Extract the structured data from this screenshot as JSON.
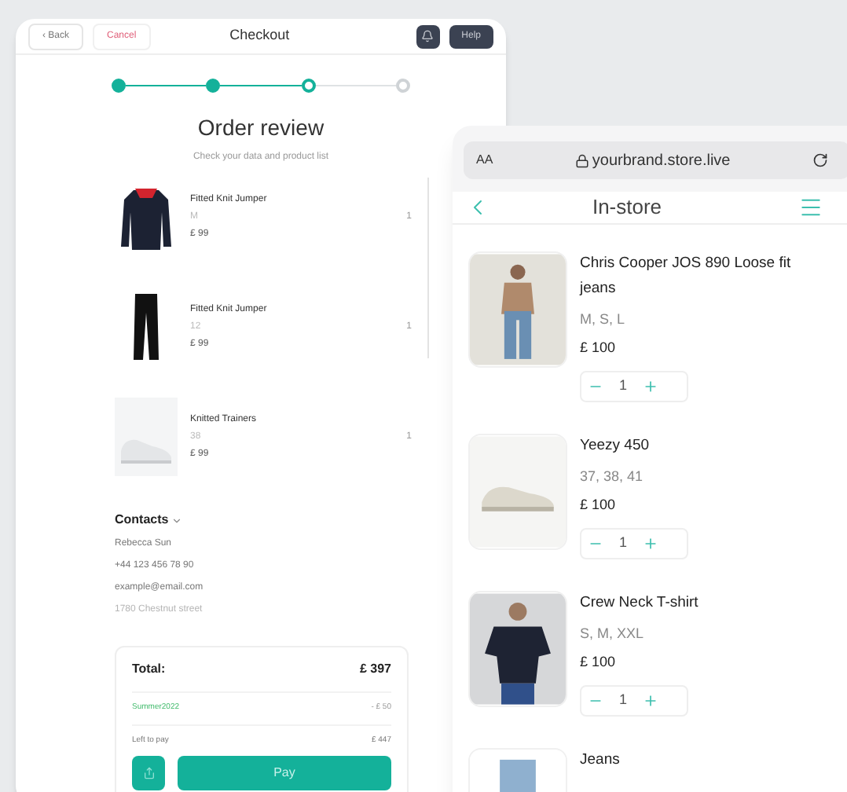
{
  "checkout": {
    "back": "‹ Back",
    "cancel": "Cancel",
    "title": "Checkout",
    "help": "Help",
    "steps": [
      {
        "kind": "done"
      },
      {
        "kind": "done"
      },
      {
        "kind": "current"
      },
      {
        "kind": "pending"
      }
    ],
    "heading": "Order review",
    "subheading": "Check your data and product list",
    "items": [
      {
        "kind": "jumper",
        "name": "Fitted Knit Jumper",
        "size": "M",
        "price": "£ 99",
        "qty": "1"
      },
      {
        "kind": "trousers",
        "name": "Fitted Knit Jumper",
        "size": "12",
        "price": "£ 99",
        "qty": "1"
      },
      {
        "kind": "shoe",
        "name": "Knitted Trainers",
        "size": "38",
        "price": "£ 99",
        "qty": "1"
      }
    ],
    "contacts": {
      "title": "Contacts",
      "expanded": true,
      "lines": [
        {
          "text": "Rebecca Sun",
          "faded": false
        },
        {
          "text": "+44 123 456 78 90",
          "faded": false
        },
        {
          "text": "example@email.com",
          "faded": false
        },
        {
          "text": "1780 Chestnut street",
          "faded": true
        }
      ]
    },
    "summary": {
      "total_label": "Total:",
      "total": "£ 397",
      "promo": "Summer2022",
      "discount": "- £ 50",
      "left_label": "Left to pay",
      "left": "£ 447",
      "pay": "Pay"
    }
  },
  "store": {
    "text_size": "AA",
    "url": "yourbrand.store.live",
    "title": "In-store",
    "products": [
      {
        "kind": "person-jeans",
        "name": "Chris Cooper JOS 890 Loose fit jeans",
        "sizes": "M, S, L",
        "price": "£ 100",
        "qty": "1"
      },
      {
        "kind": "sneaker",
        "name": "Yeezy 450",
        "sizes": "37, 38, 41",
        "price": "£ 100",
        "qty": "1"
      },
      {
        "kind": "person-tshirt",
        "name": "Crew Neck T-shirt",
        "sizes": "S, M, XXL",
        "price": "£ 100",
        "qty": "1"
      },
      {
        "kind": "jeans",
        "name": "Jeans"
      }
    ]
  }
}
